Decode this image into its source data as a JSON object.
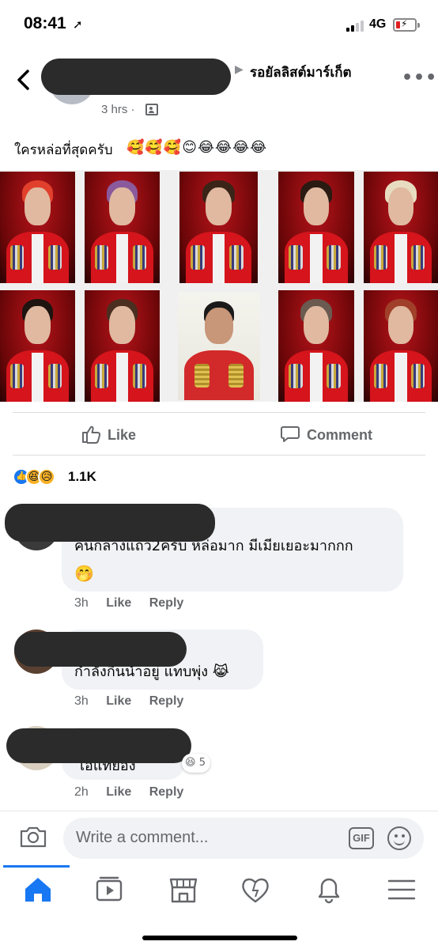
{
  "status_bar": {
    "time": "08:41",
    "location_icon": "➚",
    "network": "4G",
    "battery_color": "#e02020"
  },
  "post": {
    "group_name": "รอยัลลิสต์มาร์เก็ต",
    "time": "3 hrs ·",
    "privacy_icon": "group-privacy-icon",
    "text": "ใครหล่อที่สุดครับ",
    "emojis": "🥰🥰🥰😊😂😂😂😂"
  },
  "actions": {
    "like_label": "Like",
    "comment_label": "Comment"
  },
  "reactions": {
    "haha": "😆",
    "sad": "😥",
    "count": "1.1K"
  },
  "comments": [
    {
      "text_line1": "คนกลางแถว2ครับ หล่อมาก มีเมียเยอะมากกก",
      "text_line2": "🤭",
      "time": "3h",
      "like_label": "Like",
      "reply_label": "Reply"
    },
    {
      "text_line1": "กำลังกินน้ำอยู่ แทบพุ่ง 😹",
      "time": "3h",
      "like_label": "Like",
      "reply_label": "Reply"
    },
    {
      "text_line1": "ไอ้แทยอง",
      "reaction_emoji": "😆",
      "reaction_count": "5",
      "time": "2h",
      "like_label": "Like",
      "reply_label": "Reply"
    }
  ],
  "composer": {
    "placeholder": "Write a comment...",
    "gif_label": "GIF"
  },
  "colors": {
    "accent": "#1877f2",
    "text_secondary": "#65676b",
    "bubble": "#f0f2f5"
  }
}
